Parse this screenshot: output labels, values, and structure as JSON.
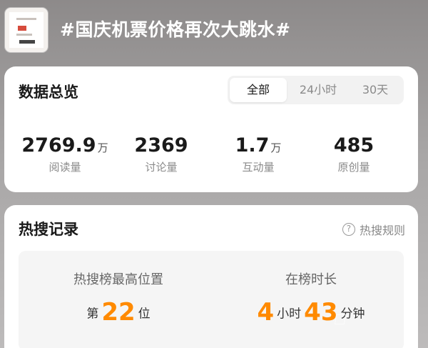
{
  "topic": {
    "title": "#国庆机票价格再次大跳水#"
  },
  "overview": {
    "title": "数据总览",
    "tabs": [
      "全部",
      "24小时",
      "30天"
    ],
    "active_tab": "全部",
    "stats": [
      {
        "value": "2769.9",
        "unit": "万",
        "label": "阅读量"
      },
      {
        "value": "2369",
        "unit": "",
        "label": "讨论量"
      },
      {
        "value": "1.7",
        "unit": "万",
        "label": "互动量"
      },
      {
        "value": "485",
        "unit": "",
        "label": "原创量"
      }
    ]
  },
  "hot": {
    "title": "热搜记录",
    "rules_label": "热搜规则",
    "help_icon": "question-circle-icon",
    "highest_rank": {
      "label": "热搜榜最高位置",
      "prefix": "第",
      "value": "22",
      "suffix": "位"
    },
    "duration": {
      "label": "在榜时长",
      "hours": "4",
      "hours_unit": "小时",
      "minutes": "43",
      "minutes_unit": "分钟"
    }
  },
  "colors": {
    "accent": "#ff8a00",
    "card_bg": "#ffffff",
    "inner_bg": "#f5f5f5"
  }
}
